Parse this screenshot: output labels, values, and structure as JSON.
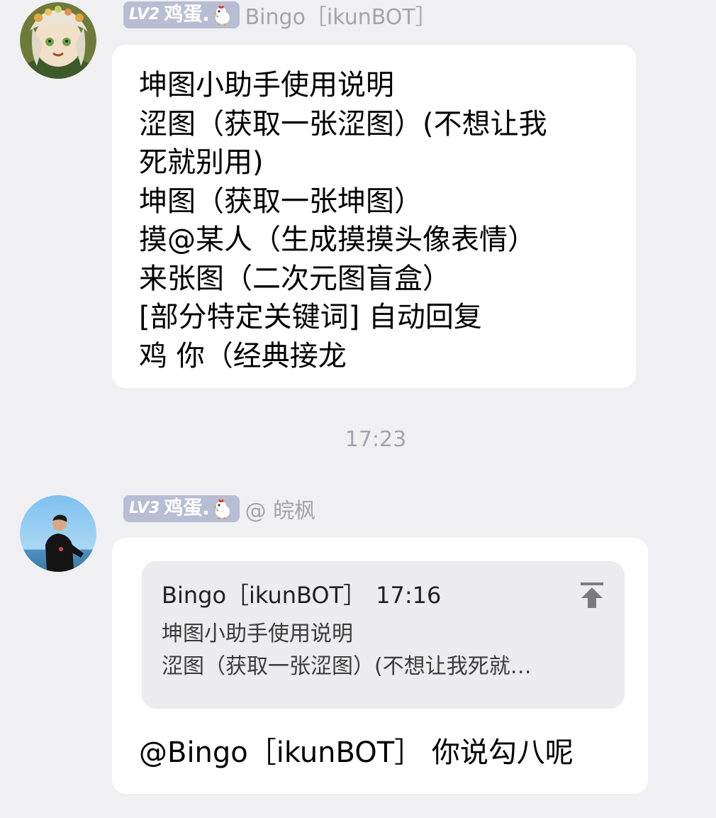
{
  "message1": {
    "level": "LV2",
    "title": "鸡蛋.",
    "sender": "Bingo［ikunBOT］",
    "lines": [
      "坤图小助手使用说明",
      "涩图（获取一张涩图）(不想让我",
      "死就别用)",
      "坤图（获取一张坤图）",
      "摸@某人（生成摸摸头像表情）",
      "来张图（二次元图盲盒）",
      "[部分特定关键词] 自动回复",
      "鸡 你（经典接龙"
    ]
  },
  "timestamp": "17:23",
  "message2": {
    "level": "LV3",
    "title": "鸡蛋.",
    "sender": "@ 皖枫",
    "quote": {
      "sender": "Bingo［ikunBOT］",
      "time": "17:16",
      "line1": "坤图小助手使用说明",
      "line2": "涩图（获取一张涩图）(不想让我死就…"
    },
    "text": "@Bingo［ikunBOT］ 你说勾八呢"
  },
  "icons": {
    "badge_emoji": "chicken-icon",
    "quote_action": "jump-to-message-icon"
  },
  "colors": {
    "background": "#f0f0f2",
    "bubble": "#ffffff",
    "badge": "#b7bdd3",
    "meta_text": "#a3a4ab",
    "quote_bg": "#ececee"
  }
}
